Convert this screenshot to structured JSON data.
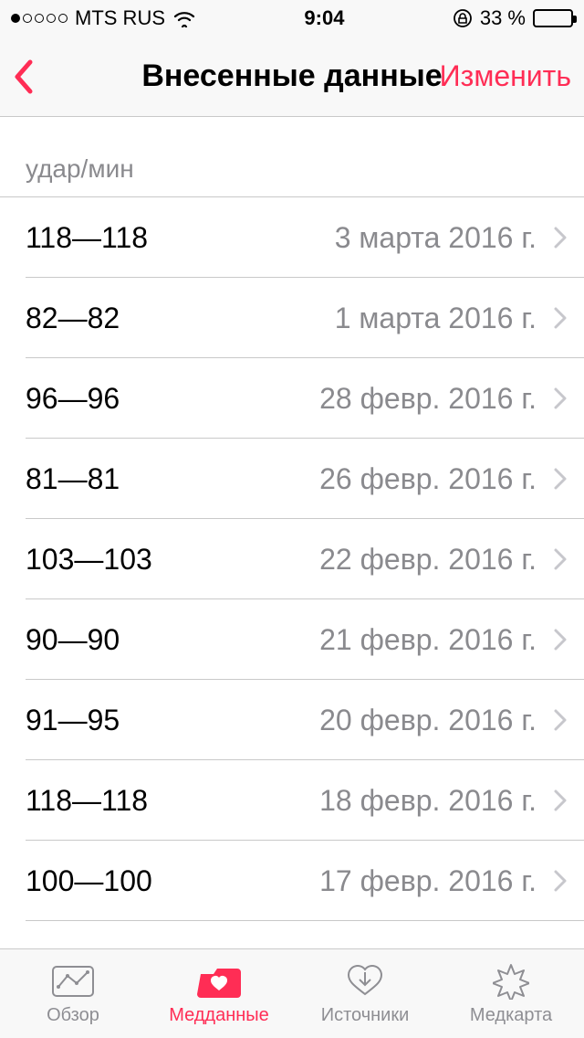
{
  "status_bar": {
    "carrier": "MTS RUS",
    "time": "9:04",
    "battery_pct": "33 %"
  },
  "nav": {
    "title": "Внесенные данные",
    "edit": "Изменить"
  },
  "section": {
    "unit": "удар/мин"
  },
  "rows": [
    {
      "value": "118—118",
      "date": "3 марта 2016 г."
    },
    {
      "value": "82—82",
      "date": "1 марта 2016 г."
    },
    {
      "value": "96—96",
      "date": "28 февр. 2016 г."
    },
    {
      "value": "81—81",
      "date": "26 февр. 2016 г."
    },
    {
      "value": "103—103",
      "date": "22 февр. 2016 г."
    },
    {
      "value": "90—90",
      "date": "21 февр. 2016 г."
    },
    {
      "value": "91—95",
      "date": "20 февр. 2016 г."
    },
    {
      "value": "118—118",
      "date": "18 февр. 2016 г."
    },
    {
      "value": "100—100",
      "date": "17 февр. 2016 г."
    }
  ],
  "tabs": {
    "overview": "Обзор",
    "health": "Медданные",
    "sources": "Источники",
    "medical": "Медкарта"
  },
  "colors": {
    "accent": "#ff2d55"
  }
}
